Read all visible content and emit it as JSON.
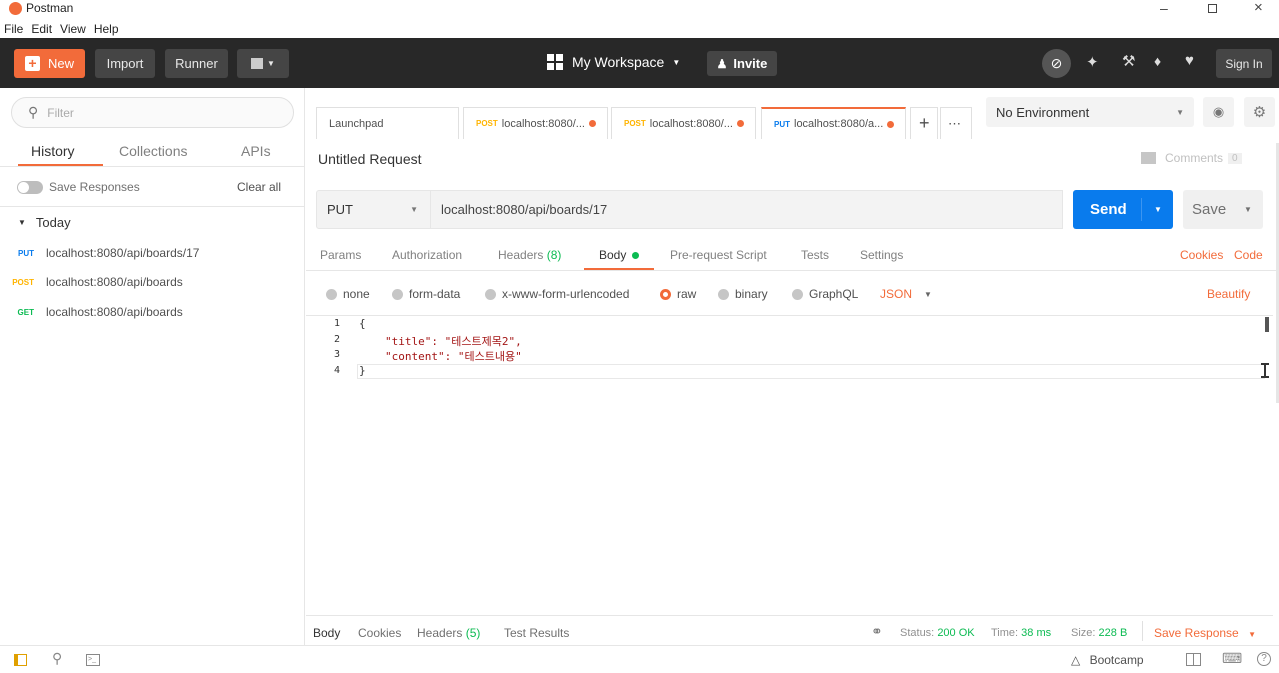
{
  "app": {
    "title": "Postman"
  },
  "menu": [
    "File",
    "Edit",
    "View",
    "Help"
  ],
  "header": {
    "new_label": "New",
    "import_label": "Import",
    "runner_label": "Runner",
    "workspace_label": "My Workspace",
    "invite_label": "Invite",
    "signin_label": "Sign In"
  },
  "sidebar": {
    "filter_placeholder": "Filter",
    "tabs": [
      "History",
      "Collections",
      "APIs"
    ],
    "save_responses_label": "Save Responses",
    "clear_all_label": "Clear all",
    "group_label": "Today",
    "items": [
      {
        "method": "PUT",
        "url": "localhost:8080/api/boards/17"
      },
      {
        "method": "POST",
        "url": "localhost:8080/api/boards"
      },
      {
        "method": "GET",
        "url": "localhost:8080/api/boards"
      }
    ]
  },
  "tabs": [
    {
      "method": "",
      "label": "Launchpad"
    },
    {
      "method": "POST",
      "label": "localhost:8080/..."
    },
    {
      "method": "POST",
      "label": "localhost:8080/..."
    },
    {
      "method": "PUT",
      "label": "localhost:8080/a..."
    }
  ],
  "environment": {
    "selected": "No Environment"
  },
  "request": {
    "name": "Untitled Request",
    "comments_label": "Comments",
    "comments_count": "0",
    "method": "PUT",
    "url": "localhost:8080/api/boards/17",
    "send_label": "Send",
    "save_label": "Save"
  },
  "subtabs": {
    "params": "Params",
    "authorization": "Authorization",
    "headers": "Headers",
    "headers_count": "(8)",
    "body": "Body",
    "prerequest": "Pre-request Script",
    "tests": "Tests",
    "settings": "Settings",
    "cookies": "Cookies",
    "code": "Code"
  },
  "body_types": {
    "none": "none",
    "form_data": "form-data",
    "urlencoded": "x-www-form-urlencoded",
    "raw": "raw",
    "binary": "binary",
    "graphql": "GraphQL",
    "format": "JSON",
    "beautify": "Beautify"
  },
  "editor": {
    "line_numbers": [
      "1",
      "2",
      "3",
      "4"
    ],
    "lines": [
      "{",
      "\"title\": \"테스트제목2\",",
      "\"content\": \"테스트내용\"",
      "}"
    ]
  },
  "response": {
    "body": "Body",
    "cookies": "Cookies",
    "headers": "Headers",
    "headers_count": "(5)",
    "test_results": "Test Results",
    "status_label": "Status:",
    "status_value": "200 OK",
    "time_label": "Time:",
    "time_value": "38 ms",
    "size_label": "Size:",
    "size_value": "228 B",
    "save_response_label": "Save Response"
  },
  "footer": {
    "bootcamp_label": "Bootcamp"
  },
  "colors": {
    "accent": "#f26b3a",
    "send": "#097bed",
    "status": "#0cbb52",
    "put": "#097bed",
    "post": "#ffb400",
    "get": "#0cbb52"
  }
}
